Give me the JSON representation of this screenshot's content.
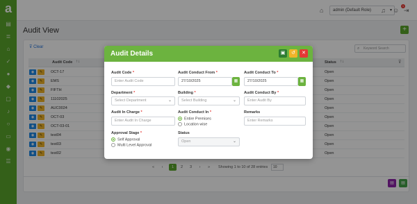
{
  "app": {
    "logo_letter": "a"
  },
  "topbar": {
    "role": "admin (Default Role)",
    "notification_count": "1"
  },
  "page": {
    "title": "Audit View",
    "add_label": "+"
  },
  "toolbar": {
    "clear_label": "Clear",
    "search_placeholder": "Keyword Search"
  },
  "table": {
    "columns": [
      "Audit Code",
      "Status"
    ],
    "rows": [
      {
        "code": "OCT-17",
        "status": "Open"
      },
      {
        "code": "EMS",
        "status": "Open"
      },
      {
        "code": "FIFTH",
        "status": "Open"
      },
      {
        "code": "11102025",
        "status": "Open"
      },
      {
        "code": "AUC0024",
        "status": "Open"
      },
      {
        "code": "OCT-03",
        "status": "Open"
      },
      {
        "code": "OCT-03-01",
        "status": "Open"
      },
      {
        "code": "test04",
        "status": "Open"
      },
      {
        "code": "test03",
        "status": "Open"
      },
      {
        "code": "test02",
        "status": "Open"
      }
    ]
  },
  "pagination": {
    "first": "«",
    "prev": "‹",
    "pages": [
      "1",
      "2",
      "3"
    ],
    "next": "›",
    "last": "»",
    "info": "Showing 1 to 10 of 28 entries",
    "per_page": "10"
  },
  "modal": {
    "title": "Audit Details",
    "fields": {
      "audit_code": {
        "label": "Audit Code",
        "placeholder": "Enter Audit Code"
      },
      "conduct_from": {
        "label": "Audit Conduct From",
        "value": "27/10/2025"
      },
      "conduct_to": {
        "label": "Audit Conduct To",
        "value": "27/10/2025"
      },
      "department": {
        "label": "Department",
        "value": "Select Department"
      },
      "building": {
        "label": "Building",
        "value": "Select Building"
      },
      "conduct_by": {
        "label": "Audit Conduct By",
        "placeholder": "Enter Audit By"
      },
      "in_charge": {
        "label": "Audit In Charge",
        "placeholder": "Enter Audit In Charge"
      },
      "conduct_in": {
        "label": "Audit Conduct In",
        "options": [
          "Entire Premises",
          "Location wise"
        ],
        "selected": "Entire Premises"
      },
      "remarks": {
        "label": "Remarks",
        "placeholder": "Enter Remarks"
      },
      "approval_stage": {
        "label": "Approval Stage",
        "options": [
          "Self Approval",
          "Multi Level Approval"
        ],
        "selected": "Self Approval"
      },
      "status": {
        "label": "Status",
        "value": "Open"
      }
    },
    "required_mark": "*"
  }
}
